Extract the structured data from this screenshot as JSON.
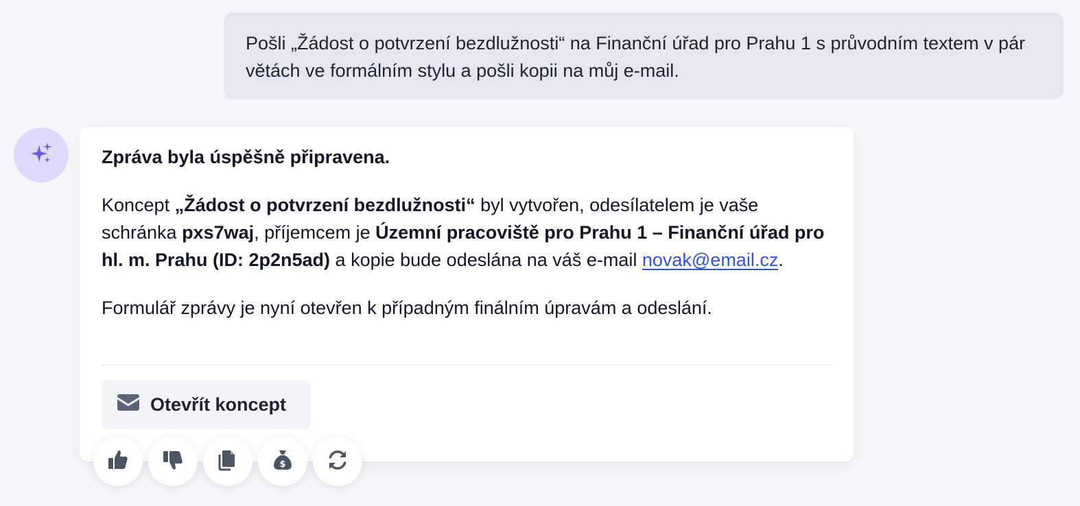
{
  "user_message": {
    "text": "Pošli „Žádost o potvrzení bezdlužnosti“ na Finanční úřad pro Prahu 1 s průvodním textem v pár větách ve formálním stylu a pošli kopii na můj e-mail."
  },
  "assistant": {
    "avatar_icon": "sparkles-icon",
    "heading": "Zpráva byla úspěšně připravena.",
    "body": {
      "t1": "Koncept ",
      "subject": "„Žádost o potvrzení bezdlužnosti“",
      "t2": " byl vytvořen, odesílatelem je vaše schránka ",
      "sender": "pxs7waj",
      "t3": ", příjemcem je ",
      "recipient": "Územní pracoviště pro Prahu 1 – Finanční úřad pro hl. m. Prahu (ID: 2p2n5ad)",
      "t4": " a kopie bude odeslána na váš e-mail ",
      "email": "novak@email.cz",
      "t5": "."
    },
    "footer_text": "Formulář zprávy je nyní otevřen k případným finálním úpravám a odeslání.",
    "open_button": {
      "label": "Otevřít koncept",
      "icon": "envelope-icon"
    }
  },
  "actions": [
    {
      "name": "like",
      "icon": "thumbs-up-icon"
    },
    {
      "name": "dislike",
      "icon": "thumbs-down-icon"
    },
    {
      "name": "copy",
      "icon": "copy-icon"
    },
    {
      "name": "cost",
      "icon": "money-bag-icon"
    },
    {
      "name": "regenerate",
      "icon": "refresh-icon"
    }
  ],
  "colors": {
    "background": "#f6f7fa",
    "user_bubble": "#e4e7f0",
    "avatar_bg": "#ddd9fb",
    "avatar_icon": "#6b5ce7",
    "link": "#2f54eb",
    "icon": "#4b5563"
  }
}
